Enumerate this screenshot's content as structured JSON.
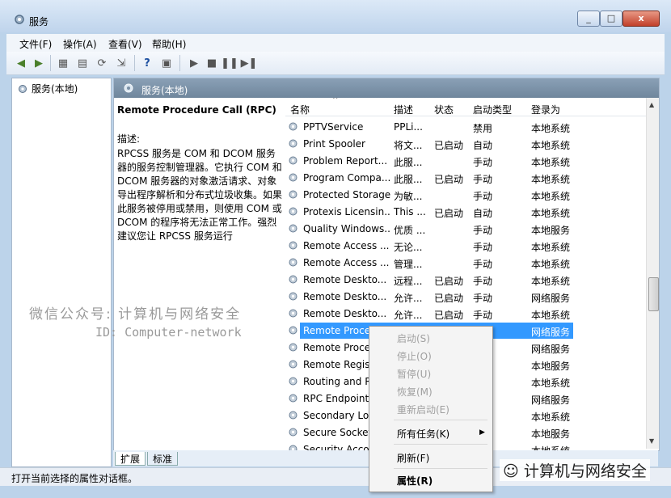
{
  "window": {
    "title": "服务"
  },
  "controls": {
    "minimize": "_",
    "maximize": "□",
    "close": "x"
  },
  "menu": [
    "文件(F)",
    "操作(A)",
    "查看(V)",
    "帮助(H)"
  ],
  "tree": {
    "item": "服务(本地)"
  },
  "right_header": "服务(本地)",
  "description": {
    "service_name": "Remote Procedure Call (RPC)",
    "label": "描述:",
    "text": "RPCSS 服务是 COM 和 DCOM 服务器的服务控制管理器。它执行 COM 和 DCOM 服务器的对象激活请求、对象导出程序解析和分布式垃圾收集。如果此服务被停用或禁用，则使用 COM 或 DCOM 的程序将无法正常工作。强烈建议您让 RPCSS 服务运行"
  },
  "columns": {
    "name": "名称",
    "desc": "描述",
    "status": "状态",
    "startup": "启动类型",
    "logon": "登录为"
  },
  "rows": [
    {
      "name": "PPTVService",
      "desc": "PPLi...",
      "status": "",
      "startup": "禁用",
      "logon": "本地系统"
    },
    {
      "name": "Print Spooler",
      "desc": "将文...",
      "status": "已启动",
      "startup": "自动",
      "logon": "本地系统"
    },
    {
      "name": "Problem Report...",
      "desc": "此服...",
      "status": "",
      "startup": "手动",
      "logon": "本地系统"
    },
    {
      "name": "Program Compa...",
      "desc": "此服...",
      "status": "已启动",
      "startup": "手动",
      "logon": "本地系统"
    },
    {
      "name": "Protected Storage",
      "desc": "为敏...",
      "status": "",
      "startup": "手动",
      "logon": "本地系统"
    },
    {
      "name": "Protexis Licensin...",
      "desc": "This ...",
      "status": "已启动",
      "startup": "自动",
      "logon": "本地系统"
    },
    {
      "name": "Quality Windows...",
      "desc": "优质 ...",
      "status": "",
      "startup": "手动",
      "logon": "本地服务"
    },
    {
      "name": "Remote Access ...",
      "desc": "无论...",
      "status": "",
      "startup": "手动",
      "logon": "本地系统"
    },
    {
      "name": "Remote Access ...",
      "desc": "管理...",
      "status": "",
      "startup": "手动",
      "logon": "本地系统"
    },
    {
      "name": "Remote Deskto...",
      "desc": "远程...",
      "status": "已启动",
      "startup": "手动",
      "logon": "本地系统"
    },
    {
      "name": "Remote Deskto...",
      "desc": "允许...",
      "status": "已启动",
      "startup": "手动",
      "logon": "网络服务"
    },
    {
      "name": "Remote Deskto...",
      "desc": "允许...",
      "status": "已启动",
      "startup": "手动",
      "logon": "本地系统"
    },
    {
      "name": "Remote Proce",
      "desc": "",
      "status": "",
      "startup": "",
      "logon": "网络服务",
      "selected": true
    },
    {
      "name": "Remote Proce",
      "desc": "",
      "status": "",
      "startup": "",
      "logon": "网络服务"
    },
    {
      "name": "Remote Regist",
      "desc": "",
      "status": "",
      "startup": "",
      "logon": "本地服务"
    },
    {
      "name": "Routing and R",
      "desc": "",
      "status": "",
      "startup": "",
      "logon": "本地系统"
    },
    {
      "name": "RPC Endpoint",
      "desc": "",
      "status": "",
      "startup": "",
      "logon": "网络服务"
    },
    {
      "name": "Secondary Log",
      "desc": "",
      "status": "",
      "startup": "",
      "logon": "本地系统"
    },
    {
      "name": "Secure Socket",
      "desc": "",
      "status": "",
      "startup": "",
      "logon": "本地服务"
    },
    {
      "name": "Security Accou",
      "desc": "",
      "status": "",
      "startup": "",
      "logon": "本地系统"
    }
  ],
  "tabs": [
    "扩展",
    "标准"
  ],
  "status_text": "打开当前选择的属性对话框。",
  "context_menu": {
    "start": "启动(S)",
    "stop": "停止(O)",
    "pause": "暂停(U)",
    "resume": "恢复(M)",
    "restart": "重新启动(E)",
    "all_tasks": "所有任务(K)",
    "refresh": "刷新(F)",
    "properties": "属性(R)"
  },
  "watermark": {
    "line1": "微信公众号: 计算机与网络安全",
    "line2": "ID: Computer-network",
    "brand": "计算机与网络安全"
  },
  "colors": {
    "selection": "#3399ff",
    "header": "#7a90a6"
  }
}
